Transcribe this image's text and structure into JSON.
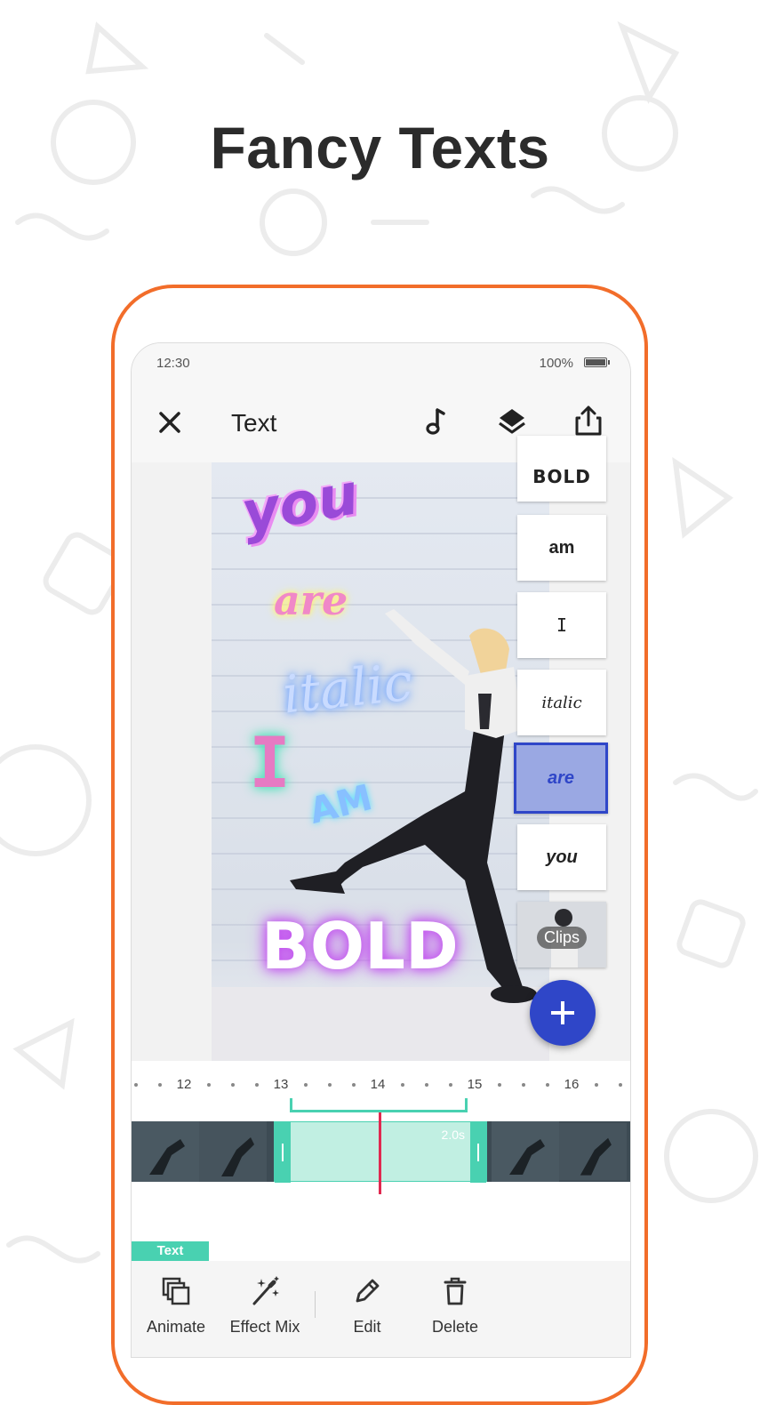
{
  "headline": "Fancy Texts",
  "status_bar": {
    "time": "12:30",
    "battery": "100%"
  },
  "app_bar": {
    "title": "Text"
  },
  "canvas": {
    "fancy_texts": [
      "you",
      "are",
      "italic",
      "I",
      "AM",
      "BOLD"
    ]
  },
  "layers": [
    {
      "label": "BOLD",
      "selected": false
    },
    {
      "label": "am",
      "selected": false
    },
    {
      "label": "I",
      "selected": false
    },
    {
      "label": "italic",
      "selected": false
    },
    {
      "label": "are",
      "selected": true
    },
    {
      "label": "you",
      "selected": false
    },
    {
      "label": "Clips",
      "selected": false
    }
  ],
  "timeline": {
    "ticks": [
      "12",
      "13",
      "14",
      "15",
      "16"
    ],
    "clip_duration": "2.0s",
    "track_tag": "Text"
  },
  "toolbar": [
    {
      "label": "Animate",
      "icon": "animate-icon"
    },
    {
      "label": "Effect Mix",
      "icon": "magic-wand-icon"
    },
    {
      "label": "Edit",
      "icon": "pencil-icon"
    },
    {
      "label": "Delete",
      "icon": "trash-icon"
    }
  ],
  "colors": {
    "accent": "#2f46c8",
    "frame": "#f26d2a",
    "timeline_accent": "#49d1b1",
    "playhead": "#e0294f"
  }
}
